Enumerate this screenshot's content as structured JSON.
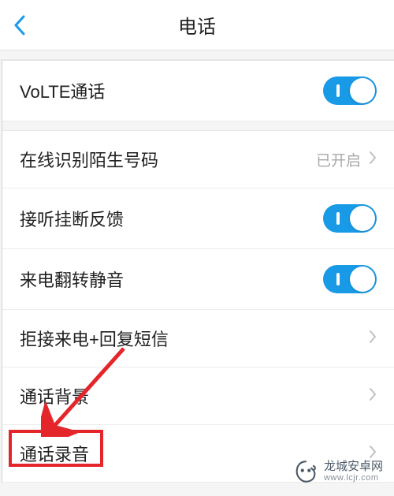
{
  "header": {
    "title": "电话"
  },
  "rows": {
    "volte": {
      "label": "VoLTE通话"
    },
    "identify": {
      "label": "在线识别陌生号码",
      "value": "已开启"
    },
    "feedback": {
      "label": "接听挂断反馈"
    },
    "flip_mute": {
      "label": "来电翻转静音"
    },
    "reject_sms": {
      "label": "拒接来电+回复短信"
    },
    "call_bg": {
      "label": "通话背景"
    },
    "call_record": {
      "label": "通话录音"
    }
  },
  "watermark": {
    "line1": "龙城安卓网",
    "line2": "www.lcjr.com"
  },
  "colors": {
    "accent": "#189ae6",
    "highlight": "#e4262b"
  }
}
